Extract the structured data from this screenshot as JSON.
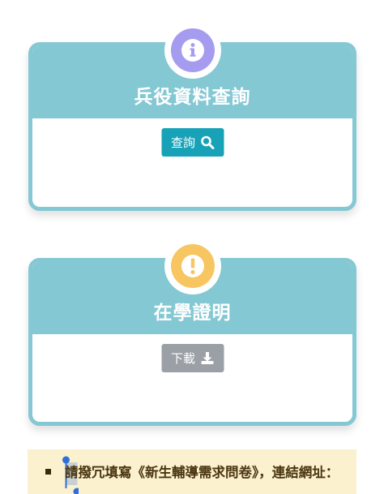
{
  "cards": [
    {
      "title": "兵役資料查詢",
      "button_label": "查詢",
      "badge_icon": "info-icon",
      "badge_color": "#a59cf0",
      "button_icon": "search-icon",
      "button_color": "#17a2b8"
    },
    {
      "title": "在學證明",
      "button_label": "下載",
      "badge_icon": "exclamation-icon",
      "badge_color": "#f7c660",
      "button_icon": "download-icon",
      "button_color": "#9aa0a6"
    }
  ],
  "notice": {
    "text": "請撥冗填寫《新生輔導需求問卷》，連結網址："
  },
  "colors": {
    "card_border": "#84c8d3",
    "notice_background": "#fbf1cf"
  }
}
